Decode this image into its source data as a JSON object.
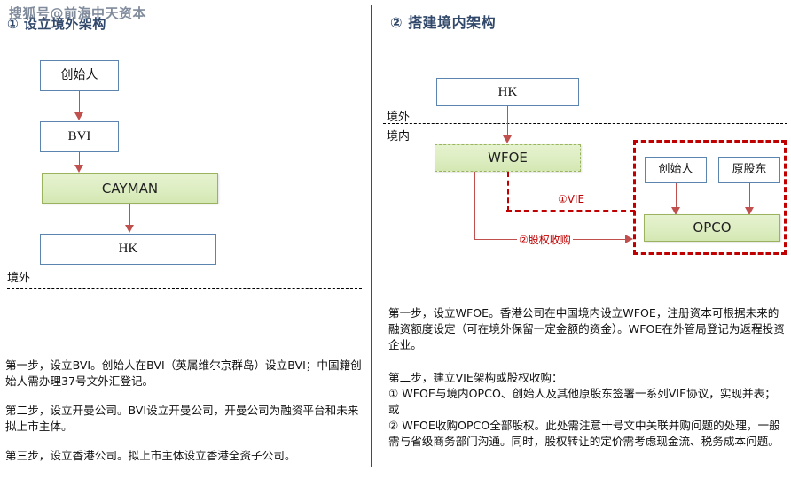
{
  "watermark": {
    "text": "搜狐号@前海中天资本"
  },
  "left_panel": {
    "title": "① 设立境外架构",
    "diagram": {
      "nodes": [
        {
          "id": "founder",
          "label": "创始人",
          "style": "blue"
        },
        {
          "id": "bvi",
          "label": "BVI",
          "style": "blue"
        },
        {
          "id": "cayman",
          "label": "CAYMAN",
          "style": "green"
        },
        {
          "id": "hk",
          "label": "HK",
          "style": "blue"
        }
      ],
      "edges": [
        {
          "from": "founder",
          "to": "bvi"
        },
        {
          "from": "bvi",
          "to": "cayman"
        },
        {
          "from": "cayman",
          "to": "hk"
        }
      ],
      "boundary_label": "境外"
    },
    "paragraphs": [
      "第一步，设立BVI。创始人在BVI（英属维尔京群岛）设立BVI；中国籍创始人需办理37号文外汇登记。",
      "第二步，设立开曼公司。BVI设立开曼公司，开曼公司为融资平台和未来拟上市主体。",
      "第三步，设立香港公司。拟上市主体设立香港全资子公司。"
    ]
  },
  "right_panel": {
    "title": "② 搭建境内架构",
    "diagram": {
      "nodes": [
        {
          "id": "hk",
          "label": "HK",
          "style": "blue"
        },
        {
          "id": "wfoe",
          "label": "WFOE",
          "style": "green-dashed"
        },
        {
          "id": "founder",
          "label": "创始人",
          "style": "blue"
        },
        {
          "id": "old_shareholder",
          "label": "原股东",
          "style": "blue"
        },
        {
          "id": "opco",
          "label": "OPCO",
          "style": "green"
        }
      ],
      "boundary_labels": {
        "offshore": "境外",
        "onshore": "境内"
      },
      "edge_labels": {
        "vie": "①VIE",
        "equity_purchase": "②股权收购"
      }
    },
    "paragraphs": [
      "第一步，设立WFOE。香港公司在中国境内设立WFOE，注册资本可根据未来的融资额度设定（可在境外保留一定金额的资金）。WFOE在外管局登记为返程投资企业。",
      "第二步，建立VIE架构或股权收购：\n① WFOE与境内OPCO、创始人及其他原股东签署一系列VIE协议，实现并表；或\n② WFOE收购OPCO全部股权。此处需注意十号文中关联并购问题的处理，一般需与省级商务部门沟通。同时，股权转让的定价需考虑现金流、税务成本问题。"
    ]
  },
  "colors": {
    "title_blue": "#31486b",
    "node_border_blue": "#5b84ae",
    "node_fill_green": "#dcedc0",
    "node_border_green": "#9bb35e",
    "arrow_red": "#c0504d",
    "dashed_red": "#c00000",
    "boundary_black": "#000000"
  }
}
